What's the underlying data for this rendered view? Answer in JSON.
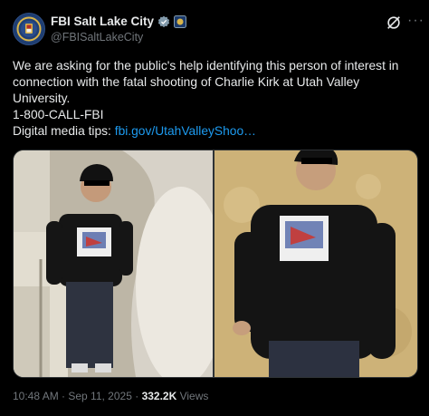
{
  "post": {
    "display_name": "FBI Salt Lake City",
    "handle": "@FBISaltLakeCity",
    "verified_badge_icon": "government-verified-badge-icon",
    "text_line1": "We are asking for the public's help identifying this person of interest in connection with the fatal shooting of Charlie Kirk at Utah Valley University.",
    "phone": "1-800-CALL-FBI",
    "media_tips_label": "Digital media tips: ",
    "media_tips_link": "fbi.gov/UtahValleyShoo…",
    "time": "10:48 AM",
    "dot1": " · ",
    "date": "Sep 11, 2025",
    "dot2": " · ",
    "views_count": "332.2K",
    "views_label": " Views"
  },
  "icons": {
    "avatar": "fbi-seal-icon",
    "grok": "grok-icon",
    "more": "more-options-icon"
  },
  "colors": {
    "background": "#000000",
    "text": "#e7e9ea",
    "muted": "#71767b",
    "link": "#1d9bf0",
    "badge_gray": "#829aab"
  }
}
